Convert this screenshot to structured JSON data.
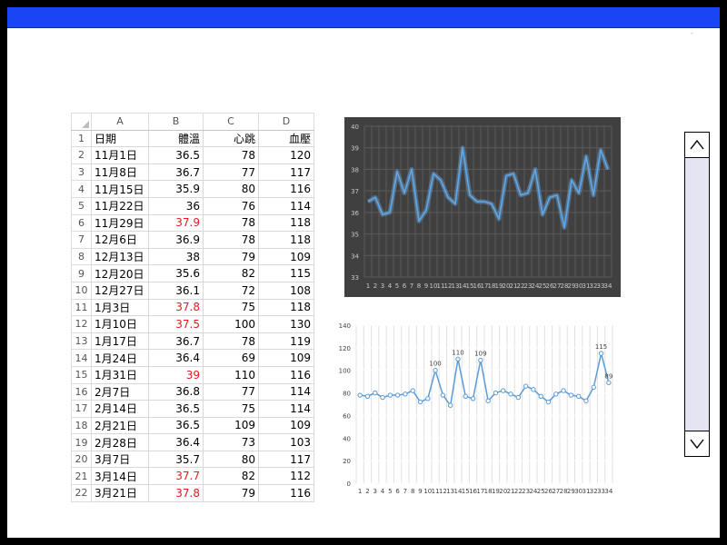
{
  "window": {
    "corner_text": "-"
  },
  "sheet": {
    "columns": [
      "A",
      "B",
      "C",
      "D"
    ],
    "rows": [
      {
        "n": "1",
        "a": "日期",
        "b": "體溫",
        "c": "心跳",
        "d": "血壓"
      },
      {
        "n": "2",
        "a": "11月1日",
        "b": "36.5",
        "c": "78",
        "d": "120"
      },
      {
        "n": "3",
        "a": "11月8日",
        "b": "36.7",
        "c": "77",
        "d": "117"
      },
      {
        "n": "4",
        "a": "11月15日",
        "b": "35.9",
        "c": "80",
        "d": "116"
      },
      {
        "n": "5",
        "a": "11月22日",
        "b": "36",
        "c": "76",
        "d": "114"
      },
      {
        "n": "6",
        "a": "11月29日",
        "b": "37.9",
        "c": "78",
        "d": "118",
        "red": true
      },
      {
        "n": "7",
        "a": "12月6日",
        "b": "36.9",
        "c": "78",
        "d": "118"
      },
      {
        "n": "8",
        "a": "12月13日",
        "b": "38",
        "c": "79",
        "d": "109"
      },
      {
        "n": "9",
        "a": "12月20日",
        "b": "35.6",
        "c": "82",
        "d": "115"
      },
      {
        "n": "10",
        "a": "12月27日",
        "b": "36.1",
        "c": "72",
        "d": "108"
      },
      {
        "n": "11",
        "a": "1月3日",
        "b": "37.8",
        "c": "75",
        "d": "118",
        "red": true
      },
      {
        "n": "12",
        "a": "1月10日",
        "b": "37.5",
        "c": "100",
        "d": "130",
        "red": true
      },
      {
        "n": "13",
        "a": "1月17日",
        "b": "36.7",
        "c": "78",
        "d": "119"
      },
      {
        "n": "14",
        "a": "1月24日",
        "b": "36.4",
        "c": "69",
        "d": "109"
      },
      {
        "n": "15",
        "a": "1月31日",
        "b": "39",
        "c": "110",
        "d": "116",
        "red": true
      },
      {
        "n": "16",
        "a": "2月7日",
        "b": "36.8",
        "c": "77",
        "d": "114"
      },
      {
        "n": "17",
        "a": "2月14日",
        "b": "36.5",
        "c": "75",
        "d": "114"
      },
      {
        "n": "18",
        "a": "2月21日",
        "b": "36.5",
        "c": "109",
        "d": "109"
      },
      {
        "n": "19",
        "a": "2月28日",
        "b": "36.4",
        "c": "73",
        "d": "103"
      },
      {
        "n": "20",
        "a": "3月7日",
        "b": "35.7",
        "c": "80",
        "d": "117"
      },
      {
        "n": "21",
        "a": "3月14日",
        "b": "37.7",
        "c": "82",
        "d": "112",
        "red": true
      },
      {
        "n": "22",
        "a": "3月21日",
        "b": "37.8",
        "c": "79",
        "d": "116",
        "red": true
      }
    ]
  },
  "colors": {
    "titlebar": "#1a45f2",
    "red_text": "#e21b1b",
    "chart1_bg": "#404040",
    "chart1_line": "#5aa9ec",
    "chart2_line": "#5b9bd5"
  },
  "chart_data": [
    {
      "type": "line",
      "background": "dark",
      "x": [
        1,
        2,
        3,
        4,
        5,
        6,
        7,
        8,
        9,
        10,
        11,
        12,
        13,
        14,
        15,
        16,
        17,
        18,
        19,
        20,
        21,
        22,
        23,
        24,
        25,
        26,
        27,
        28,
        29,
        30,
        31,
        32,
        33,
        34
      ],
      "series": [
        {
          "values": [
            36.5,
            36.7,
            35.9,
            36,
            37.9,
            36.9,
            38,
            35.6,
            36.1,
            37.8,
            37.5,
            36.7,
            36.4,
            39,
            36.8,
            36.5,
            36.5,
            36.4,
            35.7,
            37.7,
            37.8,
            36.8,
            36.9,
            38,
            35.9,
            36.7,
            36.8,
            35.3,
            37.5,
            36.9,
            38.6,
            36.8,
            38.9,
            38
          ]
        }
      ],
      "ylim": [
        33,
        40
      ],
      "yticks": [
        33,
        34,
        35,
        36,
        37,
        38,
        39,
        40
      ],
      "grid": true,
      "legend": "none"
    },
    {
      "type": "line",
      "background": "light",
      "x": [
        1,
        2,
        3,
        4,
        5,
        6,
        7,
        8,
        9,
        10,
        11,
        12,
        13,
        14,
        15,
        16,
        17,
        18,
        19,
        20,
        21,
        22,
        23,
        24,
        25,
        26,
        27,
        28,
        29,
        30,
        31,
        32,
        33,
        34
      ],
      "series": [
        {
          "values": [
            78,
            77,
            80,
            76,
            78,
            78,
            79,
            82,
            72,
            75,
            100,
            78,
            69,
            110,
            77,
            75,
            109,
            73,
            80,
            82,
            79,
            76,
            86,
            83,
            77,
            72,
            79,
            82,
            78,
            77,
            73,
            85,
            115,
            89
          ]
        }
      ],
      "labeled_points": [
        {
          "index": 10,
          "label": "100"
        },
        {
          "index": 13,
          "label": "110"
        },
        {
          "index": 16,
          "label": "109"
        },
        {
          "index": 32,
          "label": "115"
        },
        {
          "index": 33,
          "label": "89"
        }
      ],
      "ylim": [
        0,
        140
      ],
      "yticks": [
        0,
        20,
        40,
        60,
        80,
        100,
        120,
        140
      ],
      "grid": true,
      "legend": "none"
    }
  ]
}
